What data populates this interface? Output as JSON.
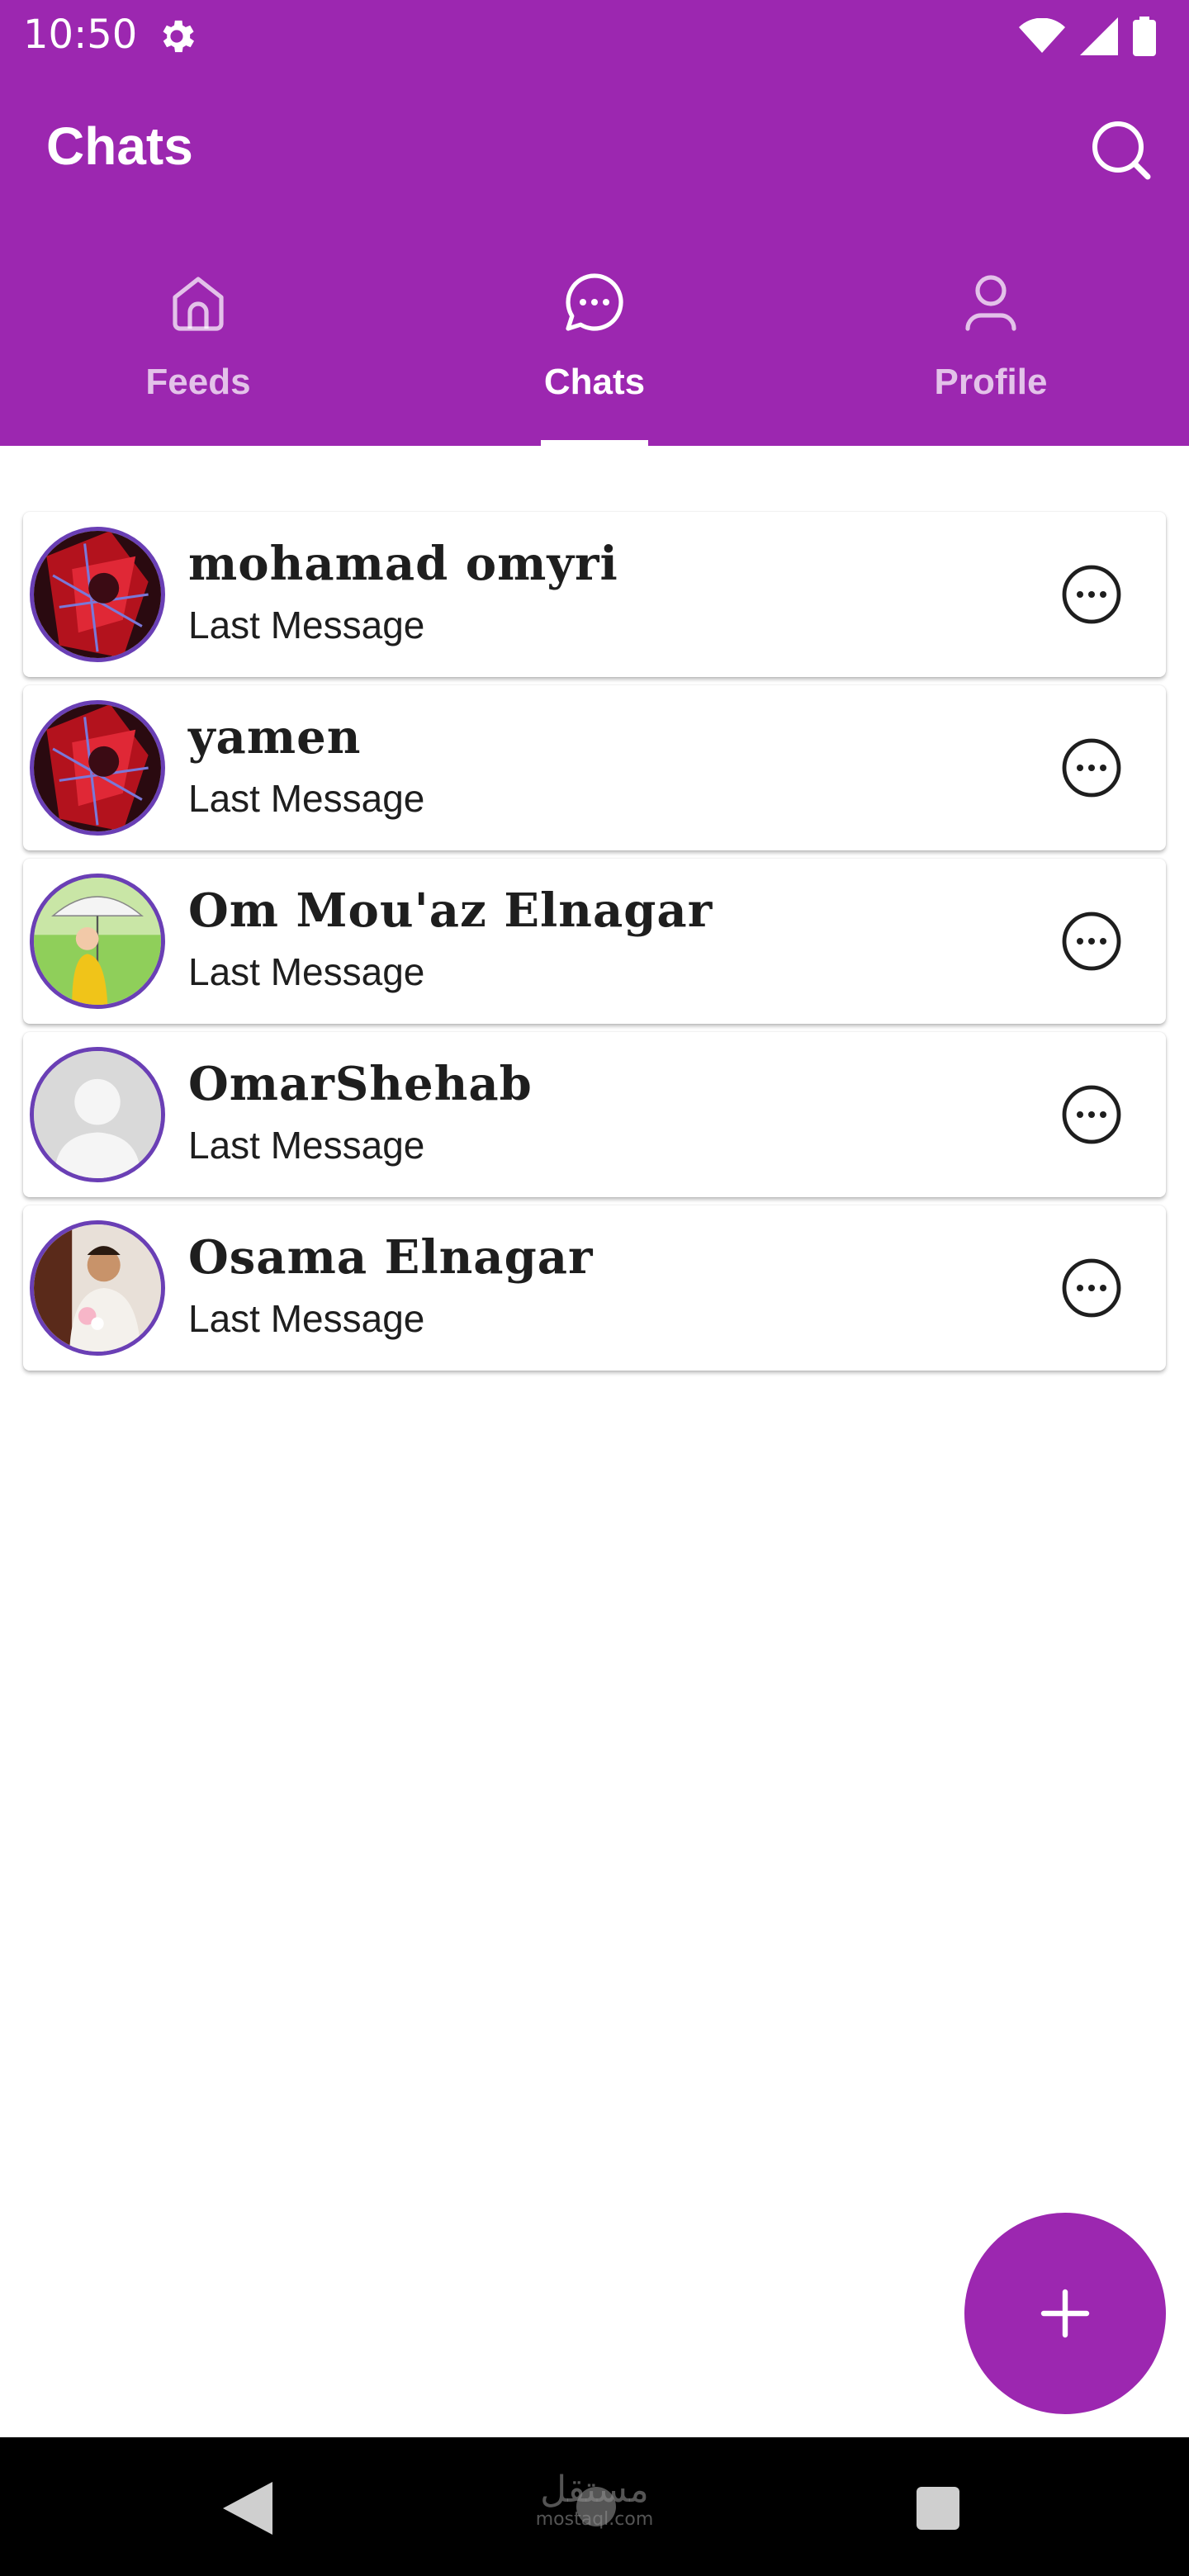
{
  "status_bar": {
    "time": "10:50"
  },
  "header": {
    "title": "Chats"
  },
  "tabs": [
    {
      "label": "Feeds",
      "icon": "home-icon",
      "active": false
    },
    {
      "label": "Chats",
      "icon": "chat-bubble-icon",
      "active": true
    },
    {
      "label": "Profile",
      "icon": "person-icon",
      "active": false
    }
  ],
  "chats": [
    {
      "name": "mohamad omyri",
      "last_message": "Last Message"
    },
    {
      "name": "yamen",
      "last_message": "Last Message"
    },
    {
      "name": "Om Mou'az Elnagar",
      "last_message": "Last Message"
    },
    {
      "name": "OmarShehab",
      "last_message": "Last Message"
    },
    {
      "name": "Osama Elnagar",
      "last_message": "Last Message"
    }
  ],
  "watermark": {
    "arabic": "مستقل",
    "latin": "mostaql.com"
  },
  "colors": {
    "primary": "#9c27b0",
    "avatar_ring": "#6a3fb5",
    "text": "#1e1e1e"
  }
}
